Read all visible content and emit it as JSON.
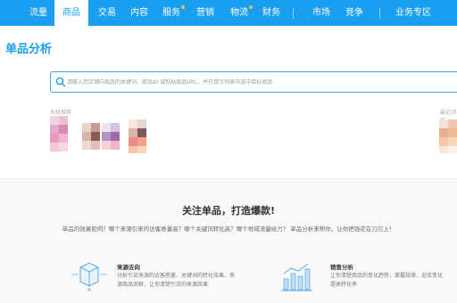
{
  "nav": {
    "items": [
      {
        "label": "流量",
        "badge": false
      },
      {
        "label": "商品",
        "badge": false,
        "active": true
      },
      {
        "label": "交易",
        "badge": false
      },
      {
        "label": "内容",
        "badge": false
      },
      {
        "label": "服务",
        "badge": true
      },
      {
        "label": "营销",
        "badge": false
      },
      {
        "label": "物流",
        "badge": true
      },
      {
        "label": "财务",
        "badge": false
      },
      {
        "label": "市场",
        "badge": false
      },
      {
        "label": "竞争",
        "badge": false
      },
      {
        "label": "业务专区",
        "badge": false
      }
    ]
  },
  "page": {
    "title": "单品分析"
  },
  "search": {
    "placeholder": "请输入您店铺内商品的关键词、商品ID 或粘贴商品URL，并在提示列表中选中目标商品"
  },
  "recommend": {
    "left_label": "系统推荐",
    "right_label": "最近浏览"
  },
  "promo": {
    "title": "关注单品，打造爆款!",
    "subtitle": "单品的效果如何？哪个来源引来的访客质量高？哪个关键词转化高？哪个地域流量给力？ 单品分析来帮你，让你把钱花在刀刃上！",
    "features": [
      {
        "title": "来源去向",
        "desc_lines": [
          "分析引流来源的访客质量、关键词的转化效果、来",
          "源商品贡献，让你清楚引流的来源效果"
        ],
        "icon": "box-source-icon"
      },
      {
        "title": "销售分析",
        "desc_lines": [
          "让你清楚商品的变化趋势，掌握规律，迎合变化",
          "提高转化率"
        ],
        "icon": "bar-trend-icon"
      }
    ]
  },
  "colors": {
    "accent": "#1a9ef0",
    "badge": "#ffc23d"
  }
}
